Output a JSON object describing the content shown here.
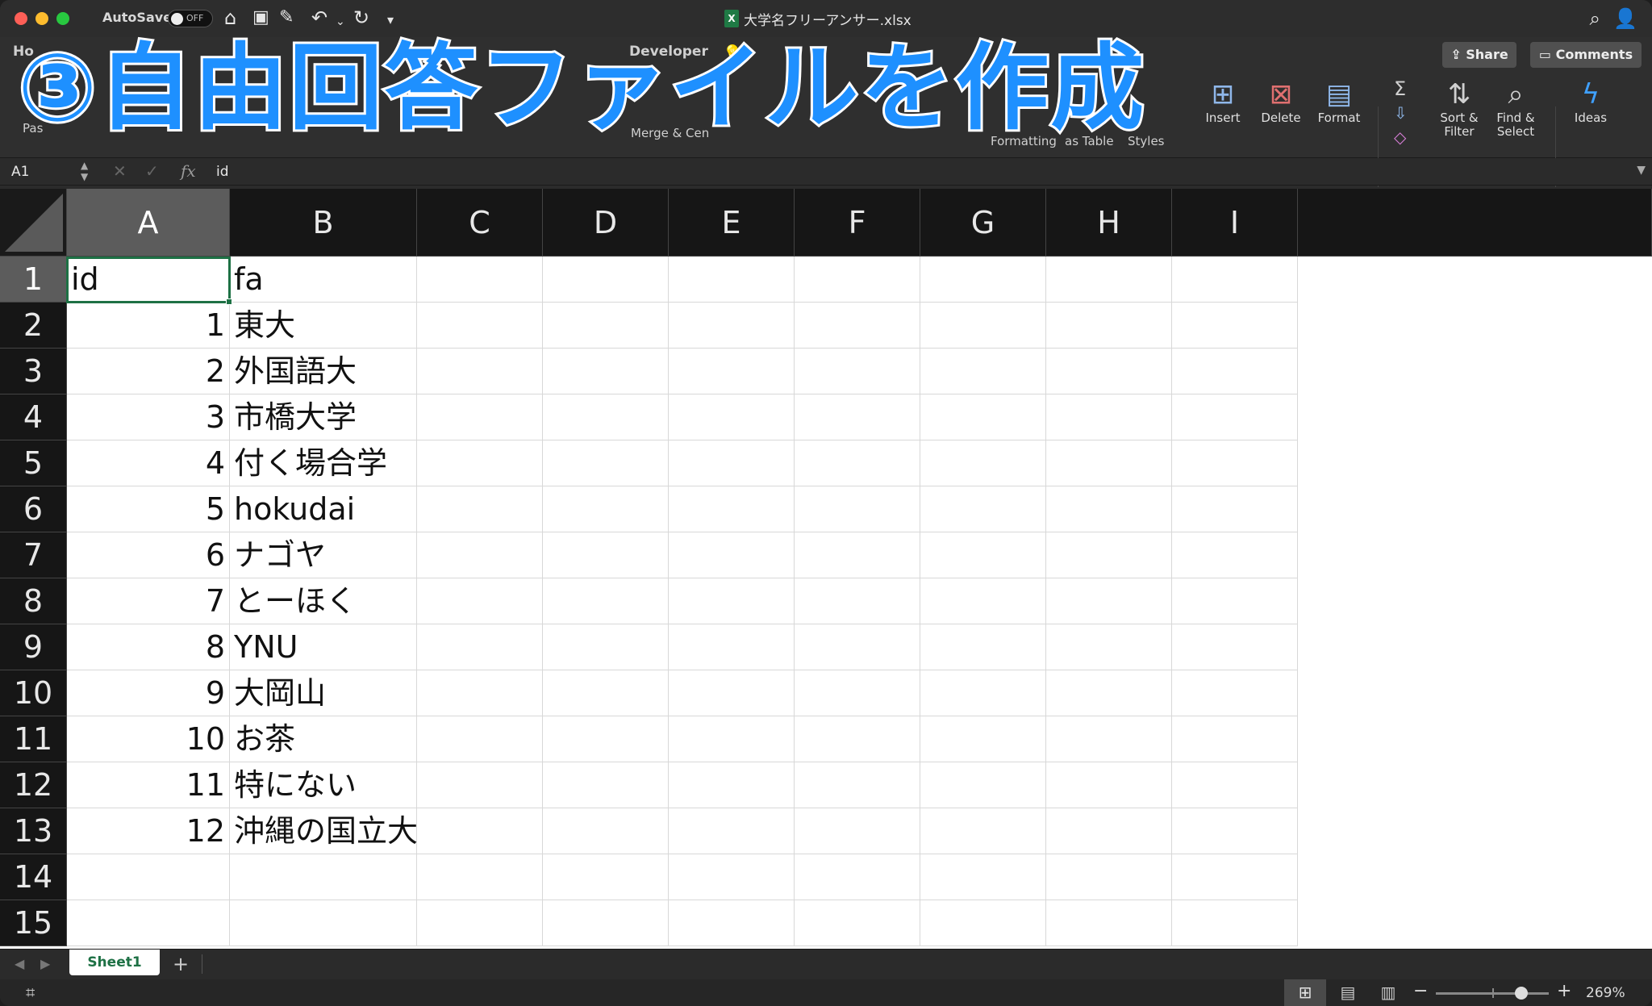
{
  "window": {
    "title": "大学名フリーアンサー.xlsx",
    "autosave_label": "AutoSave",
    "autosave_state": "OFF"
  },
  "ribbon": {
    "tabs": [
      "Ho",
      "Developer"
    ],
    "share": "Share",
    "comments": "Comments",
    "paste": "Pas",
    "merge": "Merge & Cen",
    "conditional": "Formatting",
    "format_table": "as Table",
    "styles": "Styles",
    "insert": "Insert",
    "delete": "Delete",
    "format": "Format",
    "sort_filter": "Sort & Filter",
    "find_select": "Find & Select",
    "ideas": "Ideas",
    "icons": {
      "home": "home-icon",
      "save": "save-icon",
      "undo": "undo-icon",
      "redo": "redo-icon"
    }
  },
  "banner": {
    "text": "③自由回答ファイルを作成"
  },
  "formula_bar": {
    "name_box": "A1",
    "value": "id",
    "fx": "fx"
  },
  "grid": {
    "columns": [
      "A",
      "B",
      "C",
      "D",
      "E",
      "F",
      "G",
      "H",
      "I"
    ],
    "rows": [
      {
        "num": "1",
        "a": "id",
        "b": "fa"
      },
      {
        "num": "2",
        "a": "1",
        "b": "東大"
      },
      {
        "num": "3",
        "a": "2",
        "b": "外国語大"
      },
      {
        "num": "4",
        "a": "3",
        "b": "市橋大学"
      },
      {
        "num": "5",
        "a": "4",
        "b": "付く場合学"
      },
      {
        "num": "6",
        "a": "5",
        "b": "hokudai"
      },
      {
        "num": "7",
        "a": "6",
        "b": "ナゴヤ"
      },
      {
        "num": "8",
        "a": "7",
        "b": "とーほく"
      },
      {
        "num": "9",
        "a": "8",
        "b": "YNU"
      },
      {
        "num": "10",
        "a": "9",
        "b": "大岡山"
      },
      {
        "num": "11",
        "a": "10",
        "b": "お茶"
      },
      {
        "num": "12",
        "a": "11",
        "b": "特にない"
      },
      {
        "num": "13",
        "a": "12",
        "b": "沖縄の国立大"
      },
      {
        "num": "14",
        "a": "",
        "b": ""
      },
      {
        "num": "15",
        "a": "",
        "b": ""
      }
    ]
  },
  "sheets": {
    "active": "Sheet1",
    "add": "+"
  },
  "status": {
    "zoom": "269%"
  },
  "colors": {
    "accent": "#1e7145",
    "banner": "#1e90ff"
  }
}
